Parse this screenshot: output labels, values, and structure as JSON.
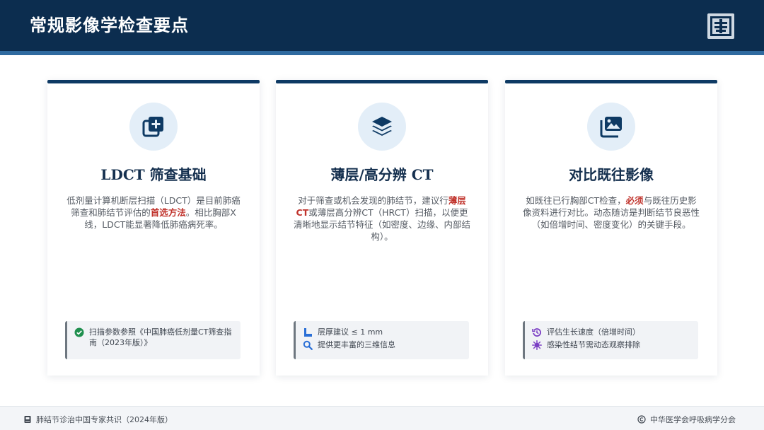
{
  "header": {
    "title": "常规影像学检查要点",
    "logo_icon": "hospital-emblem-icon"
  },
  "colors": {
    "header_bg": "#0c2d4f",
    "accent": "#0e3a64",
    "highlight": "#c0322b",
    "check_green": "#1f8f4e",
    "icon_purple": "#7b3fc4"
  },
  "cards": [
    {
      "icon": "image-plus-icon",
      "title": "LDCT 筛查基础",
      "desc_1": "低剂量计算机断层扫描（LDCT）是目前肺癌筛查和肺结节评估的",
      "desc_hl": "首选方法",
      "desc_2": "。相比胸部X线，LDCT能显著降低肺癌病死率。",
      "notes": [
        {
          "icon": "check-circle-icon",
          "text": "扫描参数参照《中国肺癌低剂量CT筛查指南（2023年版）》"
        }
      ]
    },
    {
      "icon": "layers-icon",
      "title": "薄层/高分辨 CT",
      "desc_1": "对于筛查或机会发现的肺结节，建议行",
      "desc_hl": "薄层CT",
      "desc_2": "或薄层高分辨CT（HRCT）扫描，以便更清晰地显示结节特征（如密度、边缘、内部结构）。",
      "notes": [
        {
          "icon": "ruler-icon",
          "text": "层厚建议 ≤ 1 mm"
        },
        {
          "icon": "magnifier-icon",
          "text": "提供更丰富的三维信息"
        }
      ]
    },
    {
      "icon": "images-icon",
      "title": "对比既往影像",
      "desc_1": "如既往已行胸部CT检查，",
      "desc_hl": "必须",
      "desc_2": "与既往历史影像资料进行对比。动态随访是判断结节良恶性（如倍增时间、密度变化）的关键手段。",
      "notes": [
        {
          "icon": "history-icon",
          "text": "评估生长速度（倍增时间）"
        },
        {
          "icon": "virus-icon",
          "text": "感染性结节需动态观察排除"
        }
      ]
    }
  ],
  "footer": {
    "left_icon": "book-icon",
    "left_text": "肺结节诊治中国专家共识（2024年版）",
    "right_icon": "copyright-icon",
    "right_text": "中华医学会呼吸病学分会"
  }
}
